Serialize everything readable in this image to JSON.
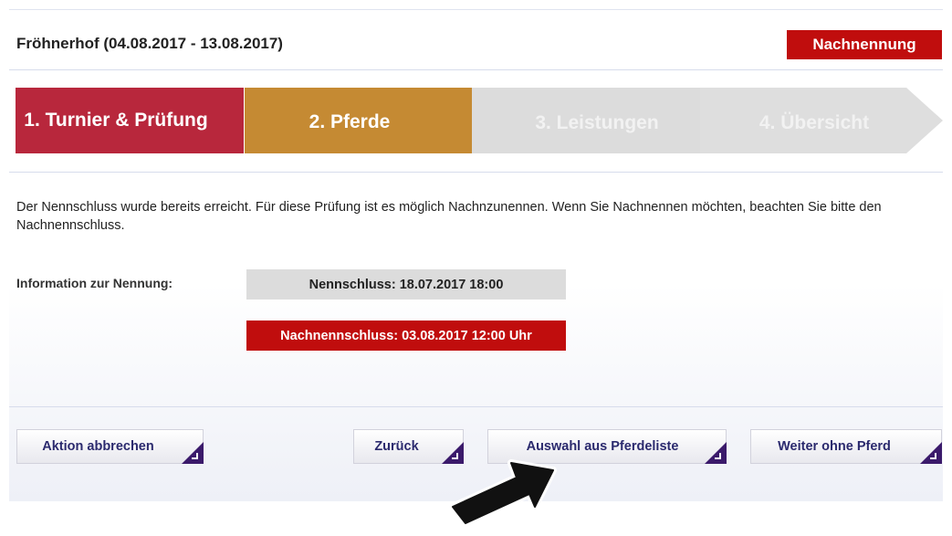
{
  "header": {
    "title": "Fröhnerhof (04.08.2017 - 13.08.2017)",
    "badge": "Nachnennung"
  },
  "steps": [
    {
      "label": "1. Turnier & Prüfung",
      "state": "completed"
    },
    {
      "label": "2. Pferde",
      "state": "active"
    },
    {
      "label": "3. Leistungen",
      "state": "pending"
    },
    {
      "label": "4. Übersicht",
      "state": "pending"
    }
  ],
  "notice": "Der Nennschluss wurde bereits erreicht. Für diese Prüfung ist es möglich Nachnzunennen. Wenn Sie Nachnennen möchten, beachten Sie bitte den Nachnennschluss.",
  "info": {
    "label": "Information zur Nennung:",
    "deadline": "Nennschluss: 18.07.2017 18:00",
    "late_deadline": "Nachnennschluss: 03.08.2017 12:00 Uhr"
  },
  "buttons": {
    "cancel": "Aktion abbrechen",
    "back": "Zurück",
    "choose": "Auswahl aus Pferdeliste",
    "next": "Weiter ohne Pferd"
  },
  "colors": {
    "step_completed": "#b8273c",
    "step_active": "#c58a33",
    "step_pending": "#dcdcdc",
    "alert_red": "#c00d0d",
    "button_text": "#2b2a6e",
    "button_corner": "#3b1a6b"
  }
}
